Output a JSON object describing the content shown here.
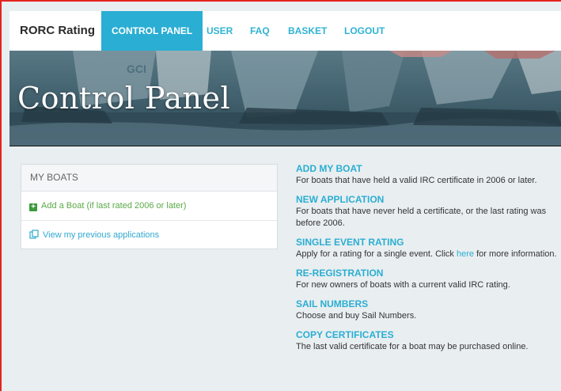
{
  "nav": {
    "brand": "RORC Rating",
    "items": [
      {
        "label": "CONTROL PANEL"
      },
      {
        "label": "USER"
      },
      {
        "label": "FAQ"
      },
      {
        "label": "BASKET"
      },
      {
        "label": "LOGOUT"
      }
    ]
  },
  "hero": {
    "title": "Control Panel",
    "sail_text": "GCI"
  },
  "my_boats": {
    "header": "MY BOATS",
    "add_boat": "Add a Boat (if last rated 2006 or later)",
    "view_previous": "View my previous applications",
    "icons": [
      "plus-square-icon",
      "copy-icon"
    ]
  },
  "sections": [
    {
      "title": "ADD MY BOAT",
      "desc": "For boats that have held a valid IRC certificate in 2006 or later."
    },
    {
      "title": "NEW APPLICATION",
      "desc": "For boats that have never held a certificate, or the last rating was before 2006."
    },
    {
      "title": "SINGLE EVENT RATING",
      "desc_before": "Apply for a rating for a single event. Click ",
      "desc_link": "here",
      "desc_after": " for more information."
    },
    {
      "title": "RE-REGISTRATION",
      "desc": "For new owners of boats with a current valid IRC rating."
    },
    {
      "title": "SAIL NUMBERS",
      "desc": "Choose and buy Sail Numbers."
    },
    {
      "title": "COPY CERTIFICATES",
      "desc": "The last valid certificate for a boat may be purchased online."
    }
  ],
  "colors": {
    "accent": "#2aaed3",
    "green": "#5aa946",
    "frame": "#e4231f"
  }
}
